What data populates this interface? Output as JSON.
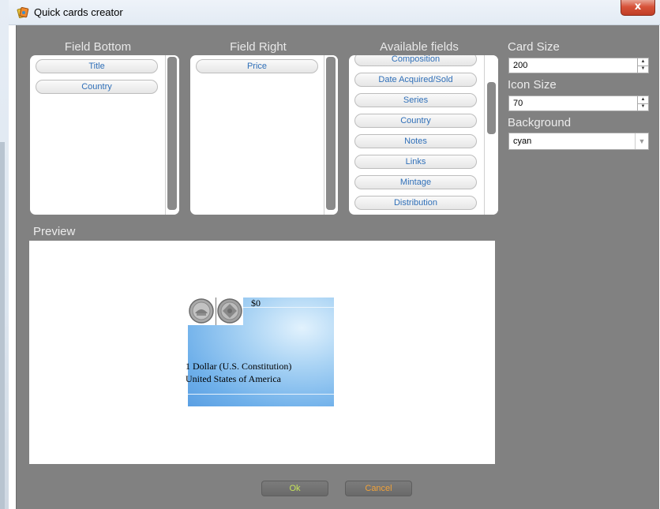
{
  "window": {
    "title": "Quick cards creator",
    "close_glyph": "x",
    "app_icon": "app-icon"
  },
  "columns": {
    "field_bottom": {
      "title": "Field Bottom",
      "items": [
        "Title",
        "Country"
      ]
    },
    "field_right": {
      "title": "Field Right",
      "items": [
        "Price"
      ]
    },
    "available": {
      "title": "Available fields",
      "items": [
        "Composition",
        "Date Acquired/Sold",
        "Series",
        "Country",
        "Notes",
        "Links",
        "Mintage",
        "Distribution"
      ]
    }
  },
  "settings": {
    "card_size_label": "Card Size",
    "card_size_value": "200",
    "icon_size_label": "Icon Size",
    "icon_size_value": "70",
    "background_label": "Background",
    "background_value": "cyan"
  },
  "preview": {
    "label": "Preview",
    "card": {
      "price": "$0",
      "line1": "1 Dollar (U.S. Constitution)",
      "line2": "United States of America",
      "icons": [
        "coin-obverse-icon",
        "coin-reverse-icon"
      ]
    }
  },
  "buttons": {
    "ok": "Ok",
    "cancel": "Cancel"
  },
  "colors": {
    "dialog_background": "#818181",
    "field_text": "#2f6fb8",
    "ok_text": "#c6e35a",
    "cancel_text": "#f0a23a"
  }
}
